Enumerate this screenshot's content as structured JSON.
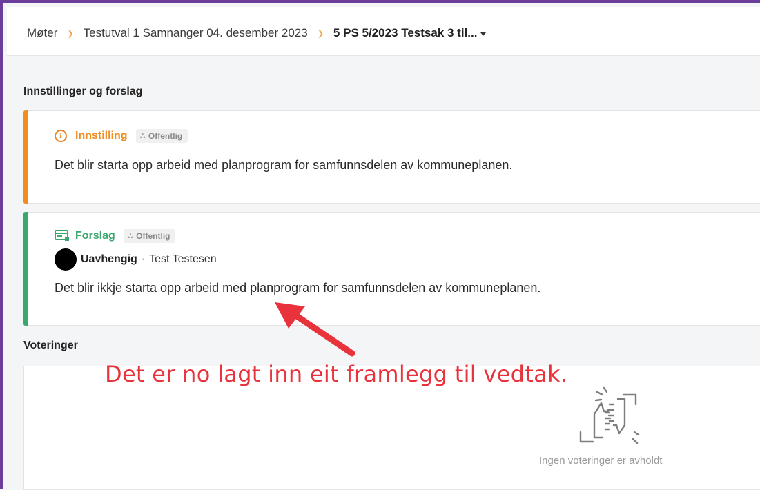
{
  "breadcrumb": {
    "items": [
      "Møter",
      "Testutval 1 Samnanger 04. desember 2023"
    ],
    "current": "5 PS 5/2023 Testsak 3 til..."
  },
  "sections": {
    "proposals_heading": "Innstillinger og forslag",
    "votes_heading": "Voteringer"
  },
  "innstilling": {
    "type_label": "Innstilling",
    "visibility": "Offentlig",
    "text": "Det blir starta opp arbeid med planprogram for samfunnsdelen av kommuneplanen.",
    "color": "#f28c1e"
  },
  "forslag": {
    "type_label": "Forslag",
    "visibility": "Offentlig",
    "party": "Uavhengig",
    "separator": "·",
    "person": "Test Testesen",
    "text": "Det blir ikkje starta opp arbeid med planprogram for samfunnsdelen av kommuneplanen.",
    "color": "#3aa76d"
  },
  "votes": {
    "empty_text": "Ingen voteringer er avholdt"
  },
  "annotation": {
    "text": "Det er no lagt inn eit framlegg til vedtak.",
    "color": "#e8323c"
  },
  "icons": {
    "breadcrumb_separator": "chevron-right-icon",
    "innstilling": "info-icon",
    "forslag": "proposal-icon",
    "visibility": "sitemap-icon",
    "empty_votes": "hands-icon"
  }
}
